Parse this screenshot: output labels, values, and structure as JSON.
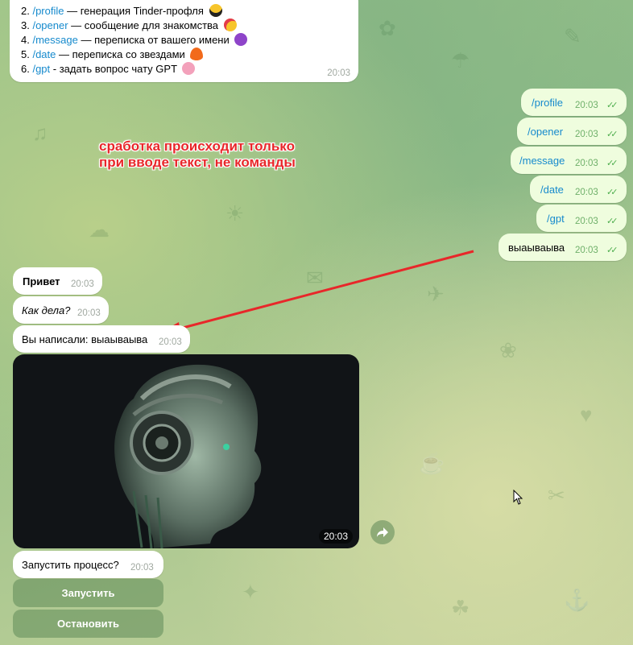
{
  "menu_message": {
    "lines": [
      {
        "num": "2.",
        "cmd": "/profile",
        "text": " — генерация Tinder-профля",
        "emoji": "sunglasses-emoji"
      },
      {
        "num": "3.",
        "cmd": "/opener",
        "text": " — сообщение для знакомства",
        "emoji": "smiling-hearts-emoji"
      },
      {
        "num": "4.",
        "cmd": "/message",
        "text": " — переписка от вашего имени",
        "emoji": "smiling-devil-emoji"
      },
      {
        "num": "5.",
        "cmd": "/date",
        "text": " — переписка со звездами",
        "emoji": "fire-emoji"
      },
      {
        "num": "6.",
        "cmd": "/gpt",
        "text": " - задать вопрос чату GPT",
        "emoji": "brain-emoji"
      }
    ],
    "time": "20:03"
  },
  "outgoing": [
    {
      "text": "/profile",
      "time": "20:03",
      "is_command": true
    },
    {
      "text": "/opener",
      "time": "20:03",
      "is_command": true
    },
    {
      "text": "/message",
      "time": "20:03",
      "is_command": true
    },
    {
      "text": "/date",
      "time": "20:03",
      "is_command": true
    },
    {
      "text": "/gpt",
      "time": "20:03",
      "is_command": true
    },
    {
      "text": "выаываыва",
      "time": "20:03",
      "is_command": false
    }
  ],
  "incoming": [
    {
      "text": "Привет",
      "time": "20:03",
      "style": "bold"
    },
    {
      "text": "Как дела?",
      "time": "20:03",
      "style": "italic"
    },
    {
      "text": "Вы написали: выаываыва",
      "time": "20:03",
      "style": "normal"
    }
  ],
  "annotation": {
    "line1": "сработка происходит только",
    "line2": "при вводе текст, не команды",
    "color": "#e8272a"
  },
  "photo": {
    "time": "20:03"
  },
  "prompt": {
    "text": "Запустить процесс?",
    "time": "20:03"
  },
  "keyboard": {
    "buttons": [
      "Запустить",
      "Остановить"
    ]
  },
  "colors": {
    "outgoing_bg": "#effdde",
    "link": "#168acd",
    "check": "#4fae4e"
  }
}
